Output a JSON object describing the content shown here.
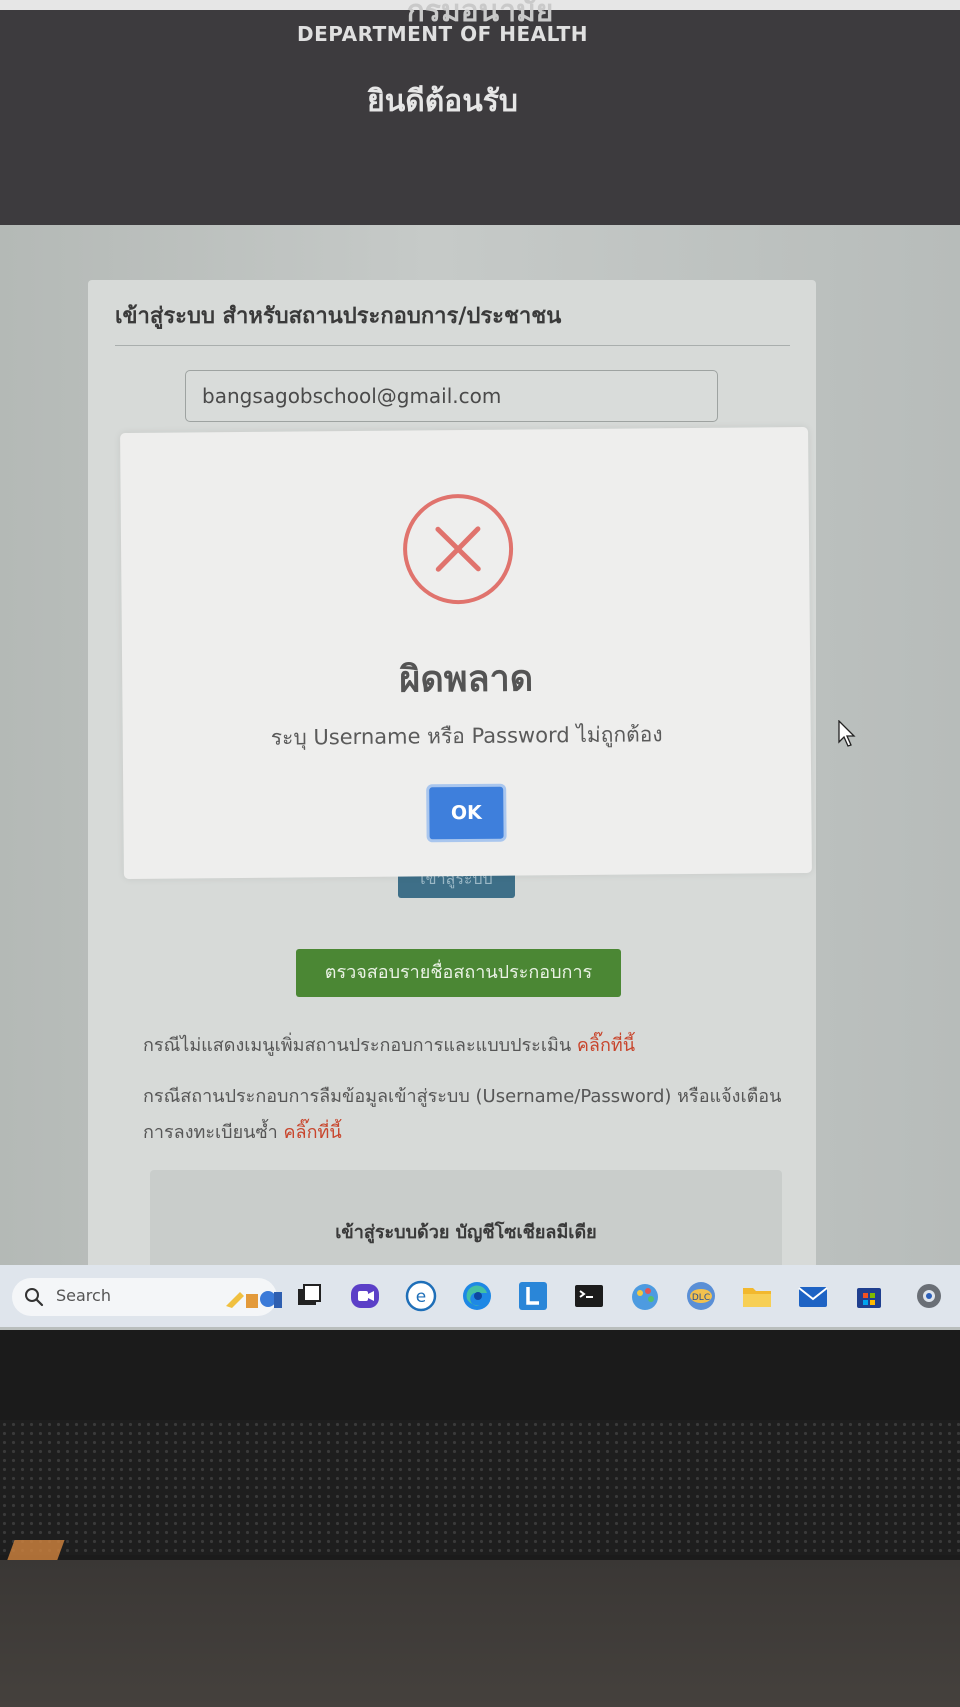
{
  "header": {
    "dept_thai": "กรมอนามัย",
    "dept_en": "DEPARTMENT OF HEALTH",
    "welcome": "ยินดีต้อนรับ"
  },
  "login": {
    "title": "เข้าสู่ระบบ สำหรับสถานประกอบการ/ประชาชน",
    "email_value": "bangsagobschool@gmail.com",
    "login_button": "เข้าสู่ระบบ",
    "check_button": "ตรวจสอบรายชื่อสถานประกอบการ",
    "note1_text": "กรณีไม่แสดงเมนูเพิ่มสถานประกอบการและแบบประเมิน ",
    "note1_link": "คลิ๊กที่นี้",
    "note2_text": "กรณีสถานประกอบการลืมข้อมูลเข้าสู่ระบบ (Username/Password) หรือแจ้งเตือนการลงทะเบียนซ้ำ ",
    "note2_link": "คลิ๊กที่นี้",
    "social_label": "เข้าสู่ระบบด้วย บัญชีโซเชียลมีเดีย"
  },
  "modal": {
    "icon": "error-x-icon",
    "title": "ผิดพลาด",
    "message": "ระบุ Username หรือ Password ไม่ถูกต้อง",
    "ok_label": "OK",
    "error_color": "#e0736d",
    "ok_color": "#3e7fdc"
  },
  "taskbar": {
    "search_placeholder": "Search",
    "apps": [
      "task-view-icon",
      "meet-icon",
      "edge-legacy-icon",
      "edge-icon",
      "line-icon",
      "terminal-icon",
      "paint-icon",
      "dlc-icon",
      "file-explorer-icon",
      "mail-icon",
      "store-icon",
      "settings-icon"
    ]
  }
}
